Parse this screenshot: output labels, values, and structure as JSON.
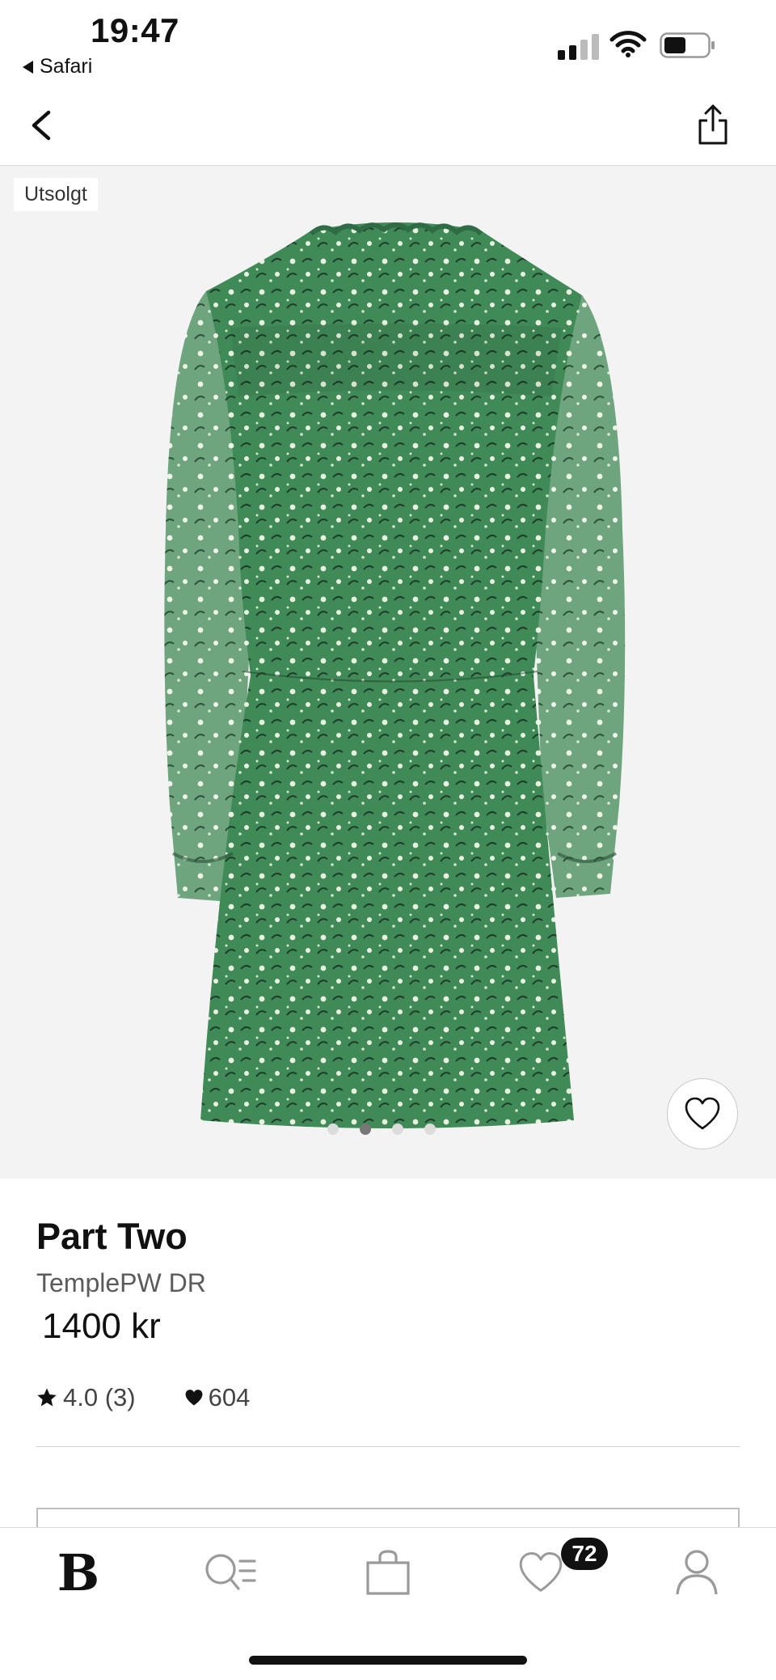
{
  "status_bar": {
    "time": "19:47",
    "back_app": "Safari"
  },
  "nav": {
    "back_icon": "chevron-left-icon",
    "share_icon": "share-icon"
  },
  "product_image": {
    "badge": "Utsolgt",
    "dot_count": 4,
    "active_dot": 2
  },
  "product": {
    "brand": "Part Two",
    "name": "TemplePW DR",
    "price": "1400 kr",
    "rating": "4.0 (3)",
    "likes": "604"
  },
  "tab_bar": {
    "home_logo": "B",
    "favorites_badge": "72",
    "items": [
      "home-logo",
      "search-icon",
      "bag-icon",
      "heart-icon",
      "profile-icon"
    ]
  },
  "colors": {
    "dress_green": "#3f8a57",
    "image_bg": "#f3f3f3",
    "text": "#111111"
  }
}
